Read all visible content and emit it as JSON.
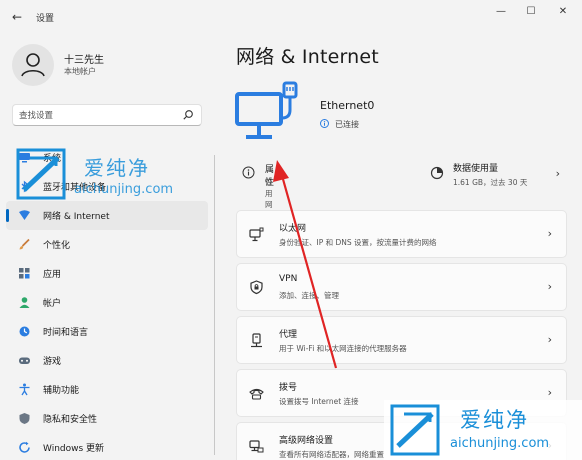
{
  "window": {
    "title": "设置",
    "minimize": "—",
    "maximize": "☐",
    "close": "✕"
  },
  "user": {
    "name": "十三先生",
    "account_type": "本地帐户"
  },
  "search": {
    "placeholder": "查找设置"
  },
  "sidebar": {
    "items": [
      {
        "label": "系统",
        "icon": "system-icon"
      },
      {
        "label": "蓝牙和其他设备",
        "icon": "bluetooth-icon"
      },
      {
        "label": "网络 & Internet",
        "icon": "network-icon",
        "active": true
      },
      {
        "label": "个性化",
        "icon": "personalization-brush-icon"
      },
      {
        "label": "应用",
        "icon": "apps-icon"
      },
      {
        "label": "帐户",
        "icon": "account-icon"
      },
      {
        "label": "时间和语言",
        "icon": "time-language-icon"
      },
      {
        "label": "游戏",
        "icon": "gaming-icon"
      },
      {
        "label": "辅助功能",
        "icon": "accessibility-icon"
      },
      {
        "label": "隐私和安全性",
        "icon": "privacy-shield-icon"
      },
      {
        "label": "Windows 更新",
        "icon": "windows-update-icon"
      }
    ]
  },
  "main": {
    "title": "网络 & Internet",
    "adapter": {
      "name": "Ethernet0",
      "status": "已连接"
    },
    "properties": {
      "title": "属性",
      "subtitle": "公用网络"
    },
    "data_usage": {
      "title": "数据使用量",
      "subtitle": "1.61 GB，过去 30 天"
    },
    "cards": [
      {
        "title": "以太网",
        "subtitle": "身份验证、IP 和 DNS 设置，按流量计费的网络",
        "icon": "ethernet-icon"
      },
      {
        "title": "VPN",
        "subtitle": "添加、连接、管理",
        "icon": "vpn-shield-icon"
      },
      {
        "title": "代理",
        "subtitle": "用于 Wi-Fi 和以太网连接的代理服务器",
        "icon": "proxy-icon"
      },
      {
        "title": "拨号",
        "subtitle": "设置拨号 Internet 连接",
        "icon": "dialup-phone-icon"
      },
      {
        "title": "高级网络设置",
        "subtitle": "查看所有网络适配器，网络重置",
        "icon": "advanced-network-icon"
      }
    ]
  },
  "watermark": {
    "name": "爱纯净",
    "url": "aichunjing.com"
  },
  "colors": {
    "accent": "#0067c0",
    "annotation_arrow": "#e02424",
    "watermark_blue": "#1a8fd8"
  }
}
